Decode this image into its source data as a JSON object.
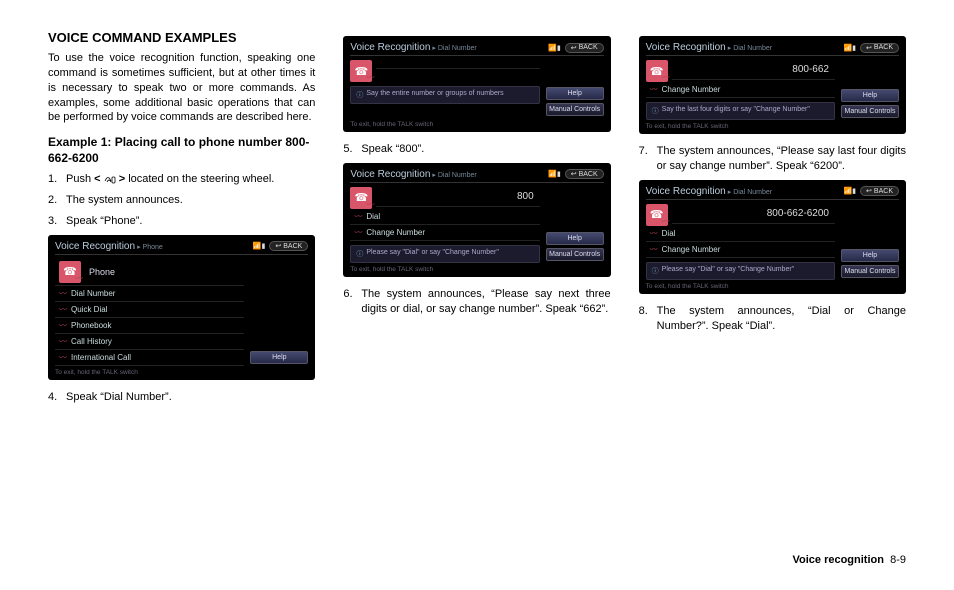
{
  "heading": "VOICE COMMAND EXAMPLES",
  "intro": "To use the voice recognition function, speaking one command is sometimes sufficient, but at other times it is necessary to speak two or more commands. As examples, some additional basic operations that can be performed by voice commands are described here.",
  "example_title": "Example 1: Placing call to phone number 800-662-6200",
  "steps": {
    "s1a": "Push ",
    "s1b": " located on the steering wheel.",
    "s2": "The system announces.",
    "s3": "Speak “Phone”.",
    "s4": "Speak “Dial Number”.",
    "s5": "Speak “800”.",
    "s6": "The system announces, “Please say next three digits or dial, or say change number”. Speak “662”.",
    "s7": "The system announces, “Please say last four digits or say change number”. Speak “6200”.",
    "s8": "The system announces, “Dial or Change Number?”. Speak “Dial”."
  },
  "screens": {
    "common": {
      "title": "Voice Recognition",
      "back": "BACK",
      "help": "Help",
      "manual": "Manual Controls",
      "footer": "To exit, hold the TALK switch"
    },
    "phone": {
      "sub": "Phone",
      "header": "Phone",
      "items": [
        "Dial Number",
        "Quick Dial",
        "Phonebook",
        "Call History",
        "International Call"
      ]
    },
    "dial1": {
      "sub": "Dial Number",
      "display": "",
      "hint": "Say the entire number or groups of numbers"
    },
    "dial2": {
      "sub": "Dial Number",
      "display": "800",
      "items": [
        "Dial",
        "Change Number"
      ],
      "hint": "Please say \"Dial\" or say \"Change Number\""
    },
    "dial3": {
      "sub": "Dial Number",
      "display": "800-662",
      "items": [
        "Change Number"
      ],
      "hint": "Say the last four digits or say \"Change Number\""
    },
    "dial4": {
      "sub": "Dial Number",
      "display": "800-662-6200",
      "items": [
        "Dial",
        "Change Number"
      ],
      "hint": "Please say \"Dial\" or say \"Change Number\""
    }
  },
  "footer": {
    "section": "Voice recognition",
    "page": "8-9"
  }
}
